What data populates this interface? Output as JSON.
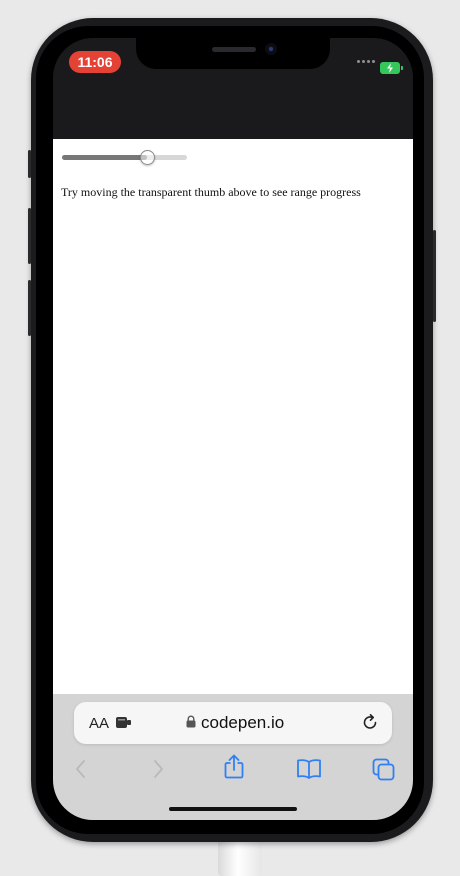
{
  "status_bar": {
    "time": "11:06"
  },
  "page": {
    "range": {
      "value": 0.68
    },
    "instruction": "Try moving the transparent thumb above to see range progress"
  },
  "address_bar": {
    "text_size_label": "AA",
    "domain": "codepen.io"
  },
  "toolbar": {
    "buttons": [
      "back-icon",
      "forward-icon",
      "share-icon",
      "bookmarks-icon",
      "tabs-icon"
    ]
  },
  "colors": {
    "accent": "#2f80f5",
    "range_fill": "#777777",
    "range_track": "#d7d7d7",
    "time_pill": "#e34235",
    "battery": "#34c759"
  }
}
